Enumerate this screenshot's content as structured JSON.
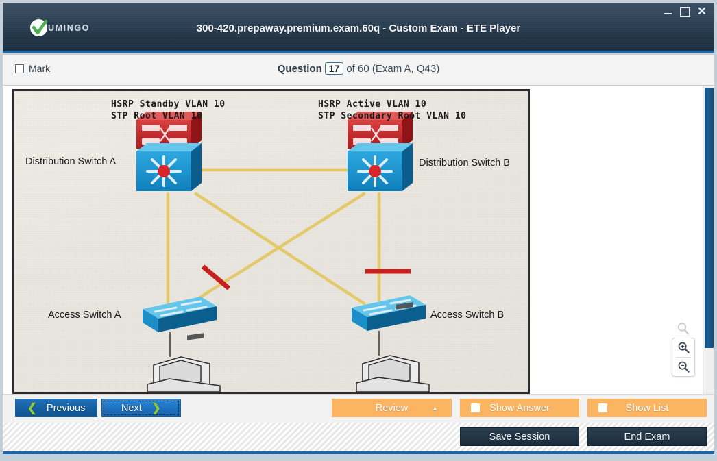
{
  "window": {
    "title": "300-420.prepaway.premium.exam.60q - Custom Exam - ETE Player",
    "logo_text": "UMINGO",
    "controls": {
      "minimize": "_",
      "maximize": "□",
      "close": "✕"
    }
  },
  "question_bar": {
    "mark_label_prefix": "M",
    "mark_label_rest": "ark",
    "question_word": "Question",
    "question_number": "17",
    "of_text": "of 60 (Exam A, Q43)"
  },
  "diagram": {
    "labels": {
      "dist_a_note_line1": "HSRP Standby VLAN 10",
      "dist_a_note_line2": "STP Root VLAN 10",
      "dist_b_note_line1": "HSRP Active VLAN 10",
      "dist_b_note_line2": "STP Secondary Root VLAN 10",
      "dist_switch_a": "Distribution Switch A",
      "dist_switch_b": "Distribution Switch B",
      "access_switch_a": "Access Switch A",
      "access_switch_b": "Access Switch B"
    },
    "colors": {
      "link": "#e4c86a",
      "blocked": "#c8201f",
      "switch_red": "#c42026",
      "switch_blue": "#1b9ad6"
    }
  },
  "zoom_tools": {
    "reset_icon": "magnifier-icon",
    "zoom_in_icon": "magnifier-plus-icon",
    "zoom_out_icon": "magnifier-minus-icon"
  },
  "buttons": {
    "previous": "Previous",
    "next": "Next",
    "review": "Review",
    "review_caret": "▲",
    "show_answer": "Show Answer",
    "show_list": "Show List",
    "save_session": "Save Session",
    "end_exam": "End Exam",
    "prev_chevron": "❮",
    "next_chevron": "❯"
  },
  "theme": {
    "accent_blue": "#1769b5",
    "orange": "#fbb461",
    "dark_navy": "#243749",
    "green_check": "#4caf50"
  }
}
